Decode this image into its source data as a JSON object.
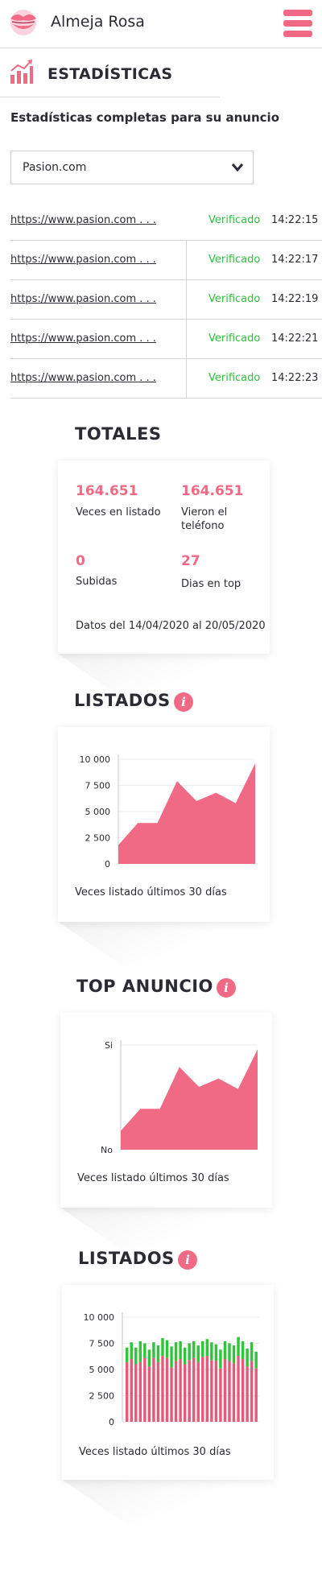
{
  "header": {
    "app_name": "Almeja Rosa",
    "logo_icon": "lips-logo-icon",
    "menu_icon": "hamburger-menu-icon"
  },
  "section": {
    "title": "ESTADÍSTICAS",
    "icon": "bar-chart-icon"
  },
  "subtitle": "Estadísticas completas para su anuncio",
  "site_select": {
    "value": "Pasion.com"
  },
  "url_rows": [
    {
      "url": "https://www.pasion.com . . .",
      "status": "Verificado",
      "time": "14:22:15"
    },
    {
      "url": "https://www.pasion.com . . .",
      "status": "Verificado",
      "time": "14:22:17"
    },
    {
      "url": "https://www.pasion.com . . .",
      "status": "Verificado",
      "time": "14:22:19"
    },
    {
      "url": "https://www.pasion.com . . .",
      "status": "Verificado",
      "time": "14:22:21"
    },
    {
      "url": "https://www.pasion.com . . .",
      "status": "Verificado",
      "time": "14:22:23"
    }
  ],
  "totales": {
    "title": "TOTALES",
    "items": [
      {
        "value": "164.651",
        "label": "Veces en listado"
      },
      {
        "value": "164.651",
        "label": "Vieron el teléfono"
      },
      {
        "value": "0",
        "label": "Subidas"
      },
      {
        "value": "27",
        "label": "Dias en top"
      }
    ],
    "range": "Datos del 14/04/2020 al 20/05/2020"
  },
  "colors": {
    "accent": "#f06a85",
    "success": "#2fbf3d",
    "bar_red": "#e55a7a",
    "bar_green": "#2fc43a"
  },
  "charts": {
    "listados": {
      "title": "LISTADOS",
      "caption": "Veces listado últimos 30 días"
    },
    "top_anuncio": {
      "title": "TOP ANUNCIO",
      "caption": "Veces listado últimos 30 días"
    },
    "listados_bars": {
      "title": "LISTADOS",
      "caption": "Veces listado últimos 30 días"
    }
  },
  "chart_data": [
    {
      "type": "area",
      "ylim": [
        0,
        10000
      ],
      "yticks": [
        "10 000",
        "7 500",
        "5 000",
        "2 500",
        "0"
      ],
      "ytick_values": [
        10000,
        7500,
        5000,
        2500,
        0
      ],
      "x": [
        0,
        1,
        2,
        3,
        4,
        5,
        6,
        7
      ],
      "values": [
        1800,
        3900,
        3900,
        7900,
        6000,
        6800,
        5800,
        9600
      ]
    },
    {
      "type": "area",
      "ylim": [
        0,
        10
      ],
      "yticks": [
        "Si",
        "No"
      ],
      "ytick_values": [
        10,
        0
      ],
      "x": [
        0,
        1,
        2,
        3,
        4,
        5,
        6,
        7
      ],
      "values": [
        1.8,
        3.9,
        3.9,
        7.9,
        6.0,
        6.8,
        5.8,
        9.6
      ]
    },
    {
      "type": "bar",
      "ylim": [
        0,
        10000
      ],
      "yticks": [
        "10 000",
        "7 500",
        "5 000",
        "2 500",
        "0"
      ],
      "ytick_values": [
        10000,
        7500,
        5000,
        2500,
        0
      ],
      "series": [
        {
          "values": [
            5700,
            6000,
            5500,
            5700,
            6100,
            5300,
            6100,
            5700,
            6300,
            6100,
            5200,
            5800,
            6000,
            5500,
            5900,
            6100,
            5700,
            6200,
            6300,
            5900,
            5800,
            5100,
            6000,
            5800,
            5600,
            6300,
            6000,
            5300,
            5800,
            5100
          ]
        },
        {
          "values": [
            1400,
            1600,
            1600,
            2000,
            1400,
            1600,
            1500,
            1600,
            1700,
            1700,
            2000,
            1800,
            1700,
            1600,
            1600,
            1600,
            1600,
            1500,
            1600,
            1700,
            1600,
            1800,
            1700,
            1700,
            1700,
            1800,
            1700,
            1700,
            1800,
            1600
          ]
        }
      ]
    }
  ]
}
